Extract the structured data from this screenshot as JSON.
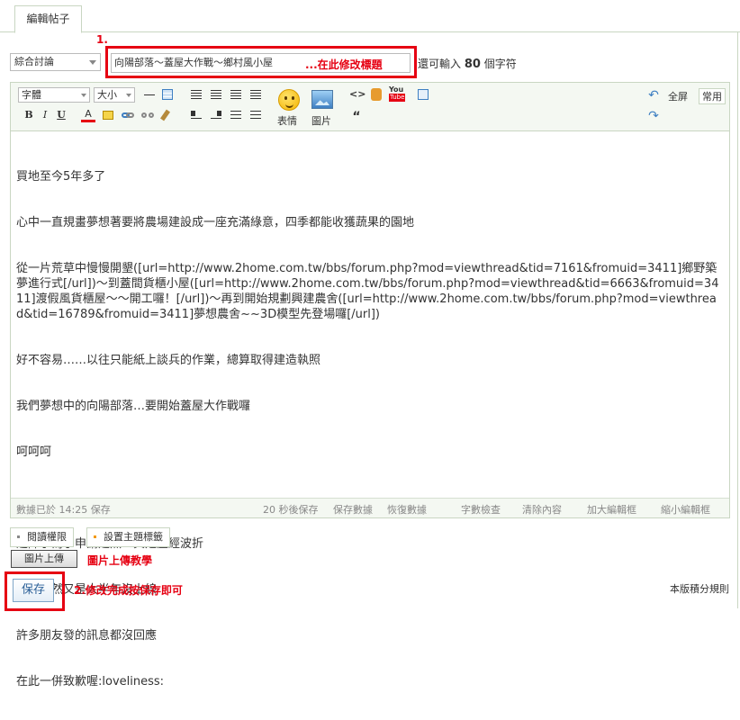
{
  "tab": {
    "label": "編輯帖子"
  },
  "annotations": {
    "step1": "1.",
    "step1_hint": "...在此修改標題",
    "step2": "2.修改完成按保存即可",
    "upload_help": "圖片上傳教學"
  },
  "category": {
    "selected": "綜合討論"
  },
  "title": {
    "value": "向陽部落～蓋屋大作戰～鄉村風小屋",
    "remaining_prefix": "還可輸入",
    "remaining_count": "80",
    "remaining_suffix": "個字符"
  },
  "toolbar": {
    "font": "字體",
    "size": "大小",
    "bold": "B",
    "italic": "I",
    "underline": "U",
    "fontcolor": "A",
    "emoji_label": "表情",
    "image_label": "圖片",
    "quote": "“",
    "code": "<>",
    "youtube_top": "You",
    "youtube_bottom": "Tube",
    "fullscreen": "全屏",
    "common": "常用"
  },
  "content": {
    "lines": [
      "買地至今5年多了",
      "心中一直規畫夢想著要將農場建設成一座充滿綠意，四季都能收獲蔬果的園地",
      "從一片荒草中慢慢開墾([url=http://www.2home.com.tw/bbs/forum.php?mod=viewthread&tid=7161&fromuid=3411]鄉野築夢進行式[/url])～到蓋間貨櫃小屋([url=http://www.2home.com.tw/bbs/forum.php?mod=viewthread&tid=6663&fromuid=3411]渡假風貨櫃屋～～開工囉！[/url])～再到開始規劃興建農舍([url=http://www.2home.com.tw/bbs/forum.php?mod=viewthread&tid=16789&fromuid=3411]夢想農舍~~3D模型先登場囉[/url])",
      "好不容易……以往只能紙上談兵的作業，總算取得建造執照",
      "我們夢想中的向陽部落…要開始蓋屋大作戰囉",
      "呵呵呵",
      "",
      "這陣子為了申請建照…真是歷經波折",
      "算算居然又是大半年沒上線",
      "許多朋友發的訊息都沒回應",
      "在此一併致歉喔:loveliness:"
    ]
  },
  "status": {
    "saved": "數據已於 14:25 保存",
    "autosave": "20 秒後保存",
    "save_data": "保存數據",
    "restore": "恢復數據",
    "wordcheck": "字數檢查",
    "clear": "清除內容",
    "enlarge": "加大編輯框",
    "shrink": "縮小編輯框"
  },
  "buttons": {
    "read_perm": "閱讀權限",
    "set_tag": "設置主題標籤",
    "upload": "圖片上傳",
    "save": "保存"
  },
  "rules": "本版積分規則",
  "colors": {
    "annotation_red": "#e60012",
    "border_green": "#c9d6c2",
    "toolbar_bg": "#f4f8f2"
  }
}
